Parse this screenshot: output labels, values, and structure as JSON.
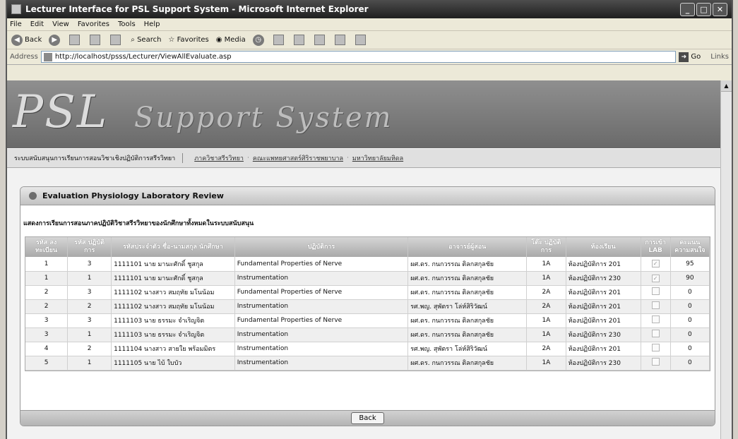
{
  "window": {
    "title": "Lecturer Interface for PSL Support System - Microsoft Internet Explorer"
  },
  "menu": [
    "File",
    "Edit",
    "View",
    "Favorites",
    "Tools",
    "Help"
  ],
  "toolbar": {
    "back": "Back",
    "search": "Search",
    "favorites": "Favorites",
    "media": "Media"
  },
  "address": {
    "label": "Address",
    "url": "http://localhost/psss/Lecturer/ViewAllEvaluate.asp",
    "go": "Go",
    "links": "Links"
  },
  "banner": {
    "logo": "PSL",
    "subtitle": "Support System"
  },
  "nav": {
    "tagline": "ระบบสนับสนุนการเรียนการสอนวิชาเชิงปฏิบัติการสรีรวิทยา",
    "links": [
      "ภาควิชาสรีรวิทยา",
      "คณะแพทยศาสตร์ศิริราชพยาบาล",
      "มหาวิทยาลัยมหิดล"
    ]
  },
  "panel": {
    "title": "Evaluation Physiology Laboratory Review",
    "subtitle": "แสดงการเรียนการสอนภาคปฏิบัติวิชาสรีรวิทยาของนักศึกษาทั้งหมดในระบบสนับสนุน"
  },
  "table": {
    "headers": [
      "รหัส ลงทะเบียน",
      "รหัส ปฏิบัติการ",
      "รหัสประจำตัว ชื่อ-นามสกุล นักศึกษา",
      "ปฏิบัติการ",
      "อาจารย์ผู้สอน",
      "โต๊ะ ปฏิบัติการ",
      "ห้องเรียน",
      "การเข้า LAB",
      "คะแนน ความสนใจ"
    ],
    "rows": [
      [
        "1",
        "3",
        "1111101 นาย มานะศักดิ์ ชูสกุล",
        "Fundamental Properties of Nerve",
        "ผศ.ดร. กนกวรรณ ติลกสกุลชัย",
        "1A",
        "ห้องปฏิบัติการ 201",
        "95"
      ],
      [
        "1",
        "1",
        "1111101 นาย มานะศักดิ์ ชูสกุล",
        "Instrumentation",
        "ผศ.ดร. กนกวรรณ ติลกสกุลชัย",
        "1A",
        "ห้องปฏิบัติการ 230",
        "90"
      ],
      [
        "2",
        "3",
        "1111102 นางสาว สมฤทัย มโนน้อม",
        "Fundamental Properties of Nerve",
        "ผศ.ดร. กนกวรรณ ติลกสกุลชัย",
        "2A",
        "ห้องปฏิบัติการ 201",
        "0"
      ],
      [
        "2",
        "2",
        "1111102 นางสาว สมฤทัย มโนน้อม",
        "Instrumentation",
        "รศ.พญ. สุพัตรา โล่ห์สิริวัฒน์",
        "2A",
        "ห้องปฏิบัติการ 201",
        "0"
      ],
      [
        "3",
        "3",
        "1111103 นาย ธรรมะ จำเริญจิต",
        "Fundamental Properties of Nerve",
        "ผศ.ดร. กนกวรรณ ติลกสกุลชัย",
        "1A",
        "ห้องปฏิบัติการ 201",
        "0"
      ],
      [
        "3",
        "1",
        "1111103 นาย ธรรมะ จำเริญจิต",
        "Instrumentation",
        "ผศ.ดร. กนกวรรณ ติลกสกุลชัย",
        "1A",
        "ห้องปฏิบัติการ 230",
        "0"
      ],
      [
        "4",
        "2",
        "1111104 นางสาว สายใย พร้อมมิตร",
        "Instrumentation",
        "รศ.พญ. สุพัตรา โล่ห์สิริวัฒน์",
        "2A",
        "ห้องปฏิบัติการ 201",
        "0"
      ],
      [
        "5",
        "1",
        "1111105 นาย ไบ้ ใบบัว",
        "Instrumentation",
        "ผศ.ดร. กนกวรรณ ติลกสกุลชัย",
        "1A",
        "ห้องปฏิบัติการ 230",
        "0"
      ]
    ],
    "attended": [
      true,
      true,
      false,
      false,
      false,
      false,
      false,
      false
    ]
  },
  "footer": {
    "back_label": "Back"
  }
}
